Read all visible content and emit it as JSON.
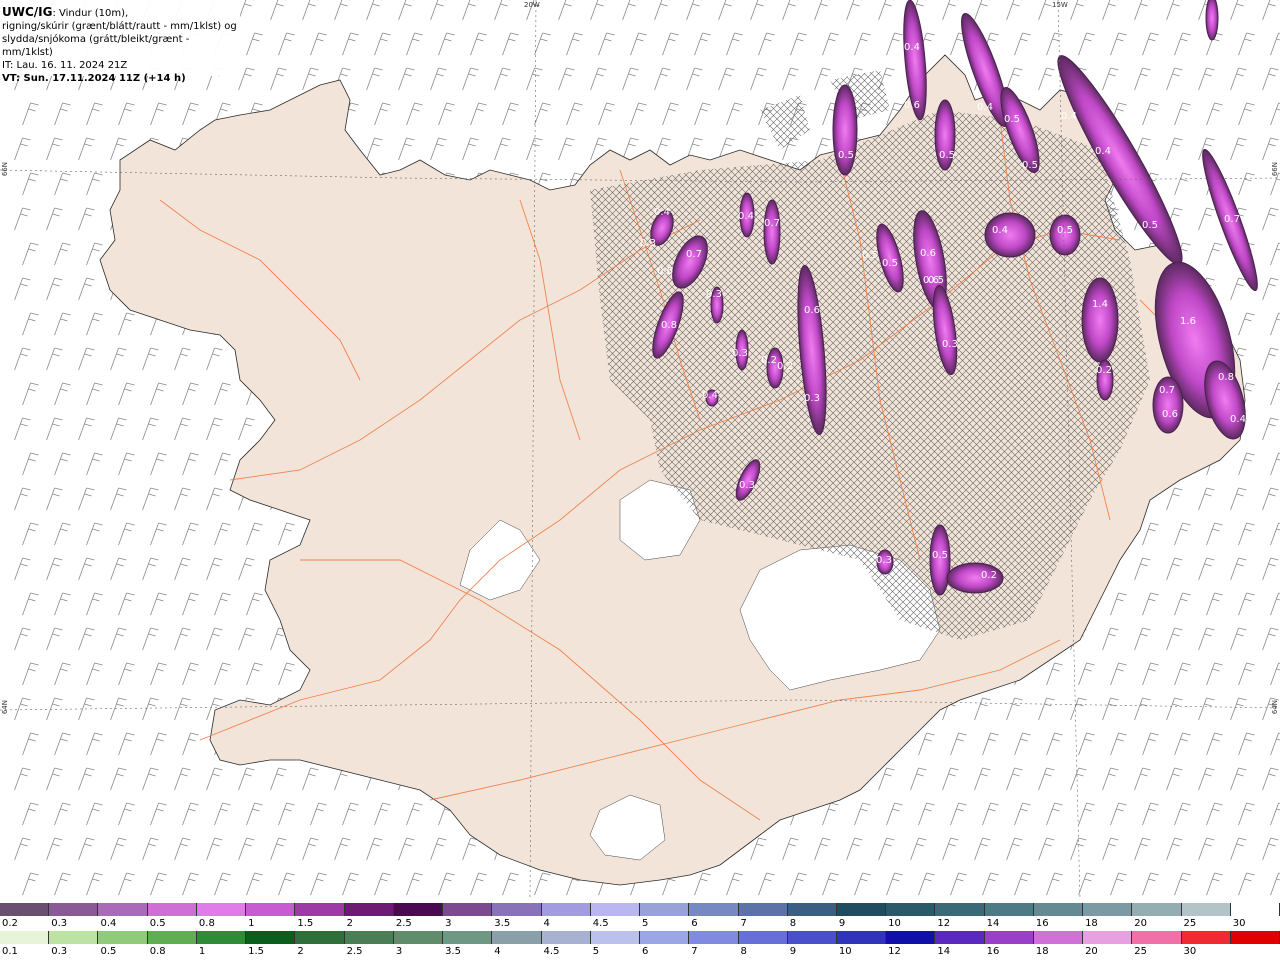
{
  "header": {
    "title": "UWC/IG",
    "line1": ": Vindur (10m),",
    "line2": "rigning/skúrir (grænt/blátt/rautt - mm/1klst) og",
    "line3": "slydda/snjókoma (grátt/bleikt/grænt - mm/1klst)",
    "init_time": "IT: Lau. 16. 11. 2024 21Z",
    "valid_time": "VT: Sun. 17.11.2024 11Z (+14 h)"
  },
  "graticule": {
    "lon_top": [
      "20W",
      "15W"
    ],
    "lat_left": [
      "66N",
      "64N"
    ],
    "lat_right": [
      "66N",
      "64N"
    ]
  },
  "precip_labels": [
    "0.4",
    "0.3",
    "0.6",
    "0.7",
    "0.8",
    "0.4",
    "0.7",
    "0.5",
    "0.4",
    "0.6",
    "0.5",
    "0.4",
    "0.5",
    "0.5",
    "0.4",
    "0.4",
    "0.5",
    "0.7",
    "0.4",
    "0.5",
    "0.5",
    "0.6",
    "0.5",
    "0.6",
    "0.3",
    "0.2",
    "0.2",
    "0.3",
    "0.3",
    "1.4",
    "1.6",
    "0.2",
    "0.7",
    "0.6",
    "0.8",
    "0.4",
    "0.3",
    "0.5",
    "0.3",
    "0.2",
    "0.6",
    "0.4",
    "0.3",
    "0.5"
  ],
  "legend": {
    "snow": {
      "values": [
        "0.2",
        "0.3",
        "0.4",
        "0.5",
        "0.8",
        "1",
        "1.5",
        "2",
        "2.5",
        "3",
        "3.5",
        "4",
        "4.5",
        "5",
        "6",
        "7",
        "8",
        "9",
        "10",
        "12",
        "14",
        "16",
        "18",
        "20",
        "25",
        "30"
      ],
      "colors": [
        "#6a5070",
        "#8a5a96",
        "#a96ab8",
        "#cf6fd6",
        "#e07ce9",
        "#c85bd1",
        "#9d3aa5",
        "#6e1a74",
        "#4a0a52",
        "#7c4a8f",
        "#8a72b9",
        "#a39be0",
        "#b9b6f0",
        "#98a2d8",
        "#7789c2",
        "#5c72a8",
        "#3a5e84",
        "#1f4c60",
        "#2a5a6a",
        "#3a6a78",
        "#4e7a86",
        "#648a94",
        "#7b9aa3",
        "#93adb3",
        "#b2c4c8",
        "#ffffff"
      ]
    },
    "rain": {
      "values": [
        "0.1",
        "0.3",
        "0.5",
        "0.8",
        "1",
        "1.5",
        "2",
        "2.5",
        "3",
        "3.5",
        "4",
        "4.5",
        "5",
        "6",
        "7",
        "8",
        "9",
        "10",
        "12",
        "14",
        "16",
        "18",
        "20",
        "25",
        "30"
      ],
      "colors": [
        "#e6f5d8",
        "#bde3a4",
        "#8fcb78",
        "#5fae52",
        "#2e8b36",
        "#0c5e1c",
        "#2f6f3a",
        "#4a7f55",
        "#5f8d6c",
        "#6f9884",
        "#8aa0a8",
        "#a6b2d0",
        "#b9c1ec",
        "#9aa6e6",
        "#7f8ae0",
        "#6670d8",
        "#4a50cc",
        "#3034bb",
        "#1010a8",
        "#5a2ac0",
        "#9a40c8",
        "#d070d8",
        "#e8a0e0",
        "#f070a8",
        "#f02a30",
        "#e00000"
      ]
    }
  }
}
